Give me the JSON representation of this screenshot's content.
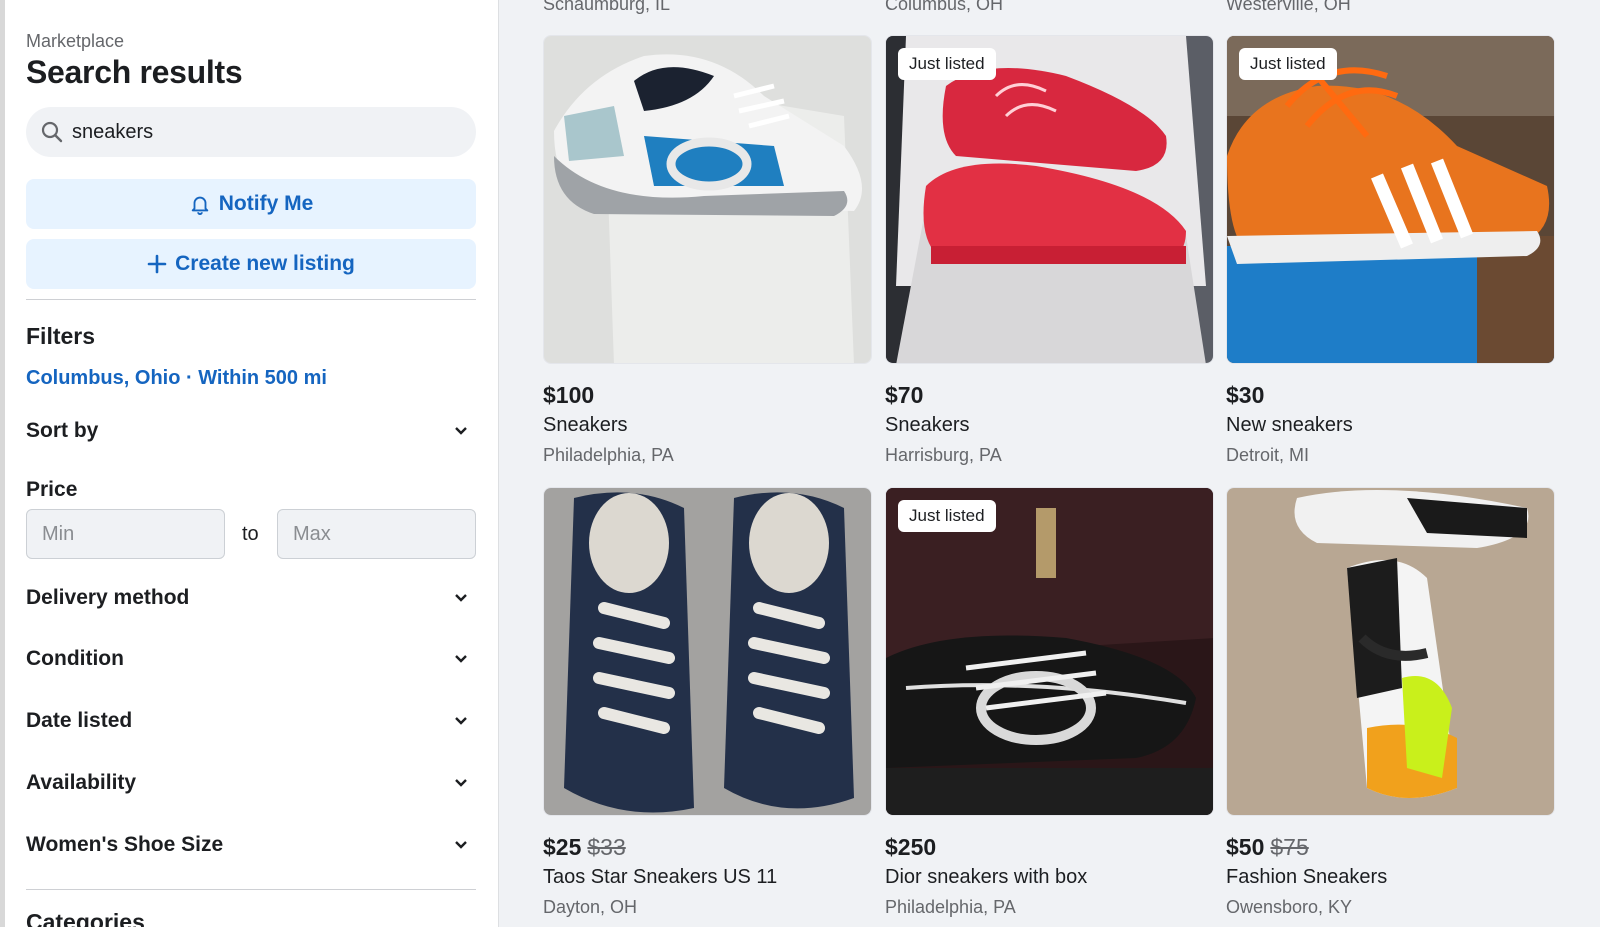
{
  "sidebar": {
    "section_label": "Marketplace",
    "title": "Search results",
    "search_value": "sneakers",
    "notify_label": "Notify Me",
    "create_label": "Create new listing",
    "filters_heading": "Filters",
    "location": "Columbus, Ohio · Within 500 mi",
    "sort_by": "Sort by",
    "price_label": "Price",
    "price_min_placeholder": "Min",
    "price_to": "to",
    "price_max_placeholder": "Max",
    "delivery": "Delivery method",
    "condition": "Condition",
    "date_listed": "Date listed",
    "availability": "Availability",
    "shoe_size": "Women's Shoe Size",
    "categories_heading": "Categories"
  },
  "top_row_locations": [
    "Schaumburg, IL",
    "Columbus, OH",
    "Westerville, OH"
  ],
  "listings": [
    {
      "price": "$100",
      "old_price": "",
      "title": "Sneakers",
      "location": "Philadelphia, PA",
      "badge": "",
      "image": "white-blue-sneaker"
    },
    {
      "price": "$70",
      "old_price": "",
      "title": "Sneakers",
      "location": "Harrisburg, PA",
      "badge": "Just listed",
      "image": "red-sneakers-box"
    },
    {
      "price": "$30",
      "old_price": "",
      "title": "New sneakers",
      "location": "Detroit, MI",
      "badge": "Just listed",
      "image": "orange-sneaker"
    },
    {
      "price": "$25",
      "old_price": "$33",
      "title": "Taos Star Sneakers US 11",
      "location": "Dayton, OH",
      "badge": "",
      "image": "navy-canvas-sneakers"
    },
    {
      "price": "$250",
      "old_price": "",
      "title": "Dior sneakers with box",
      "location": "Philadelphia, PA",
      "badge": "Just listed",
      "image": "black-sneakers-box"
    },
    {
      "price": "$50",
      "old_price": "$75",
      "title": "Fashion Sneakers",
      "location": "Owensboro, KY",
      "badge": "",
      "image": "high-top-sneaker"
    }
  ],
  "colors": {
    "accent": "#1565c0",
    "accent_bg": "#e7f3ff",
    "page_bg": "#f0f2f5"
  }
}
